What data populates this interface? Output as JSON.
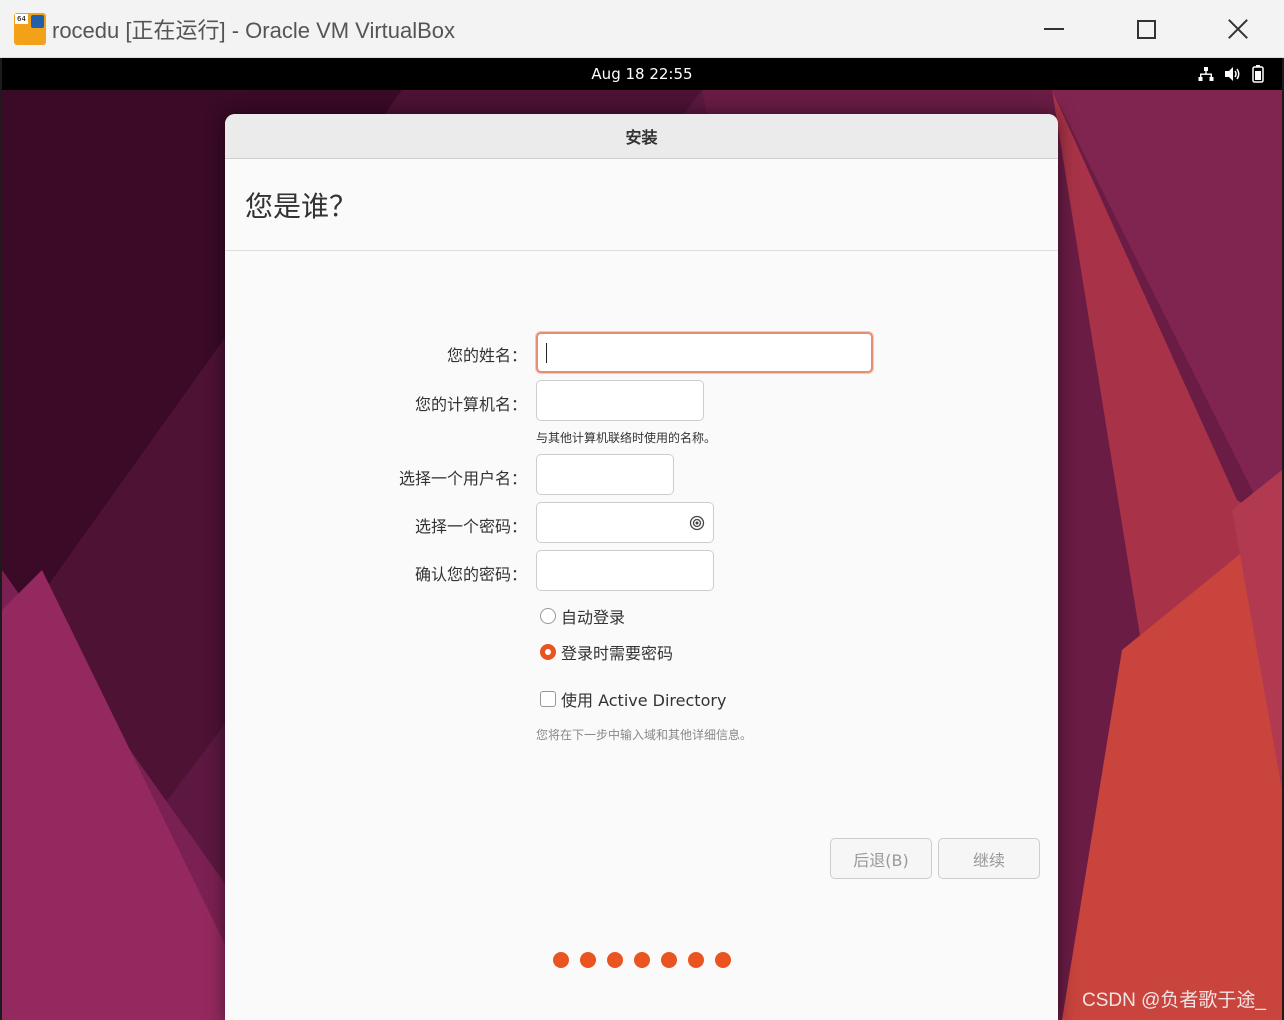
{
  "host_window": {
    "icon_badge": "64",
    "title": "rocedu [正在运行] - Oracle VM VirtualBox"
  },
  "gnome_bar": {
    "clock": "Aug 18  22:55",
    "tray_icons": [
      "network-icon",
      "volume-icon",
      "battery-icon"
    ]
  },
  "installer": {
    "window_title": "安装",
    "page_heading": "您是谁？",
    "fields": {
      "name_label": "您的姓名：",
      "name_value": "",
      "computer_label": "您的计算机名：",
      "computer_value": "",
      "computer_hint": "与其他计算机联络时使用的名称。",
      "username_label": "选择一个用户名：",
      "username_value": "",
      "password_label": "选择一个密码：",
      "password_value": "",
      "confirm_label": "确认您的密码：",
      "confirm_value": ""
    },
    "login_options": {
      "auto_login": "自动登录",
      "require_password": "登录时需要密码",
      "selected": "require_password"
    },
    "active_directory": {
      "label": "使用 Active Directory",
      "checked": false,
      "hint": "您将在下一步中输入域和其他详细信息。"
    },
    "buttons": {
      "back": "后退(B)",
      "continue": "继续"
    },
    "progress": {
      "step_count": 7
    }
  },
  "colors": {
    "accent": "#e95420",
    "focus_border": "#e98d72"
  },
  "watermark": "CSDN @负者歌于途_"
}
